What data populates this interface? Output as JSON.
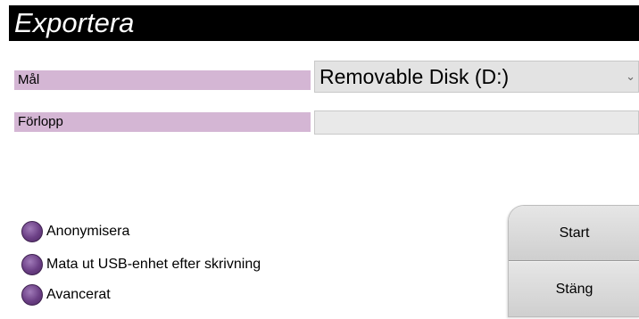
{
  "dialog": {
    "title": "Exportera"
  },
  "fields": {
    "target_label": "Mål",
    "target_value": "Removable Disk (D:)",
    "progress_label": "Förlopp",
    "progress_fraction": 0
  },
  "options": [
    {
      "label": "Anonymisera"
    },
    {
      "label": "Mata ut USB-enhet efter skrivning"
    },
    {
      "label": "Avancerat"
    }
  ],
  "buttons": {
    "start": "Start",
    "close": "Stäng"
  },
  "colors": {
    "title_bg": "#000000",
    "label_bg": "#d4b6d4",
    "radio": "#6b3f85",
    "button": "#d9d9d9"
  },
  "icons": {
    "dropdown": "chevron-down-icon"
  }
}
